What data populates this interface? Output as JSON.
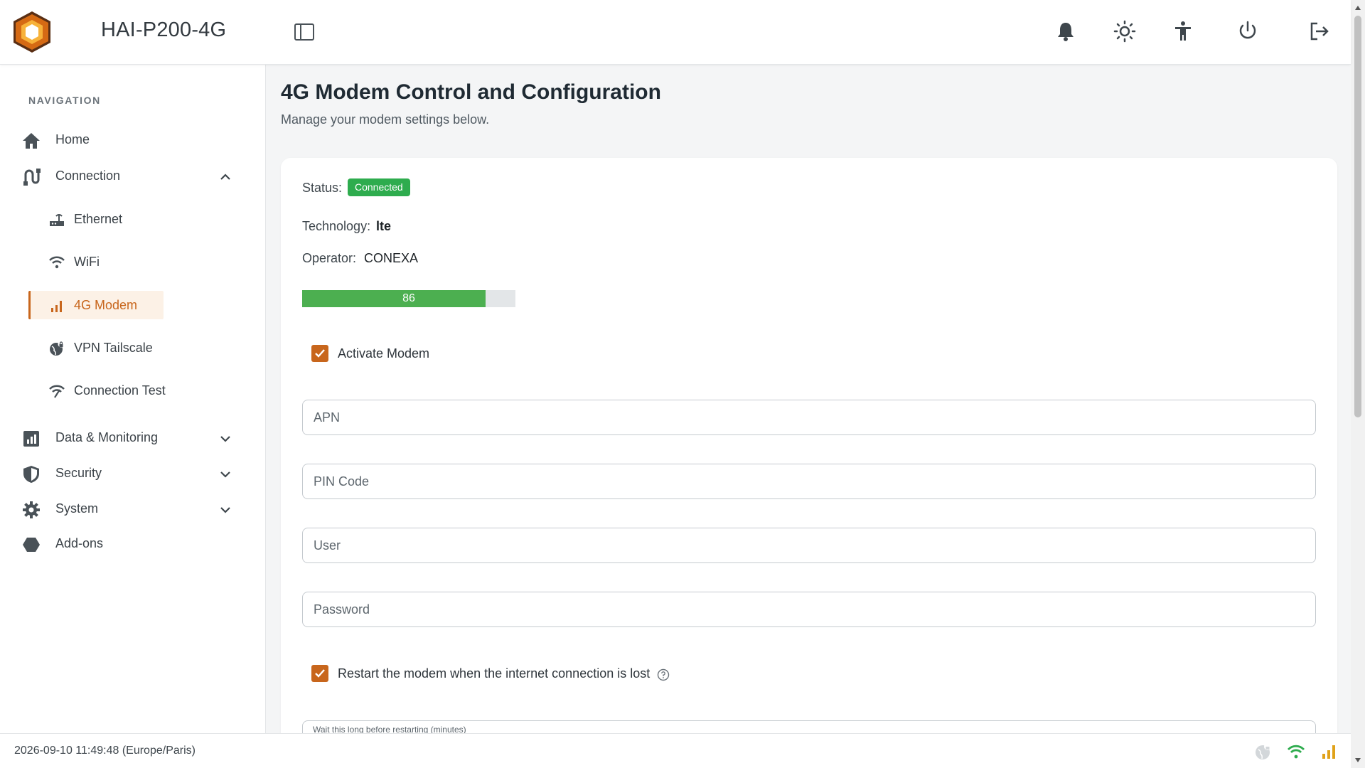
{
  "header": {
    "device_name": "HAI-P200-4G",
    "icons": [
      "sidebar-toggle-icon",
      "bell-icon",
      "sun-icon",
      "accessibility-icon",
      "power-icon",
      "logout-icon"
    ]
  },
  "sidebar": {
    "heading": "NAVIGATION",
    "items": [
      {
        "label": "Home",
        "icon": "home-icon"
      },
      {
        "label": "Connection",
        "icon": "connection-icon",
        "expanded": true
      },
      {
        "label": "Data & Monitoring",
        "icon": "chart-icon"
      },
      {
        "label": "Security",
        "icon": "shield-icon"
      },
      {
        "label": "System",
        "icon": "gear-icon"
      },
      {
        "label": "Add-ons",
        "icon": "hexagon-icon"
      }
    ],
    "connection_sub": [
      {
        "label": "Ethernet",
        "icon": "router-icon"
      },
      {
        "label": "WiFi",
        "icon": "wifi-icon"
      },
      {
        "label": "4G Modem",
        "icon": "signal-bars-icon",
        "active": true
      },
      {
        "label": "VPN Tailscale",
        "icon": "vpn-globe-icon"
      },
      {
        "label": "Connection Test",
        "icon": "wifi-test-icon"
      }
    ]
  },
  "main": {
    "title": "4G Modem Control and Configuration",
    "subtitle": "Manage your modem settings below.",
    "status_label": "Status:",
    "status_value": "Connected",
    "technology_label": "Technology:",
    "technology_value": "lte",
    "operator_label": "Operator:",
    "operator_value": "CONEXA",
    "signal_strength": 86,
    "signal_text": "86",
    "activate_label": "Activate Modem",
    "activate_checked": true,
    "fields": {
      "apn_placeholder": "APN",
      "pin_placeholder": "PIN Code",
      "user_placeholder": "User",
      "password_placeholder": "Password"
    },
    "restart_label": "Restart the modem when the internet connection is lost",
    "restart_checked": true,
    "wait_label": "Wait this long before restarting (minutes)"
  },
  "footer": {
    "datetime": "2026-09-10 11:49:48 (Europe/Paris)",
    "icons": [
      "vpn-status-icon",
      "wifi-status-icon",
      "signal-status-icon"
    ]
  },
  "colors": {
    "accent": "#c8661c",
    "connected": "#2eac4e",
    "signal_bar": "#4caf50",
    "wifi_status": "#2eac4e",
    "signal_status": "#e0a21a"
  }
}
